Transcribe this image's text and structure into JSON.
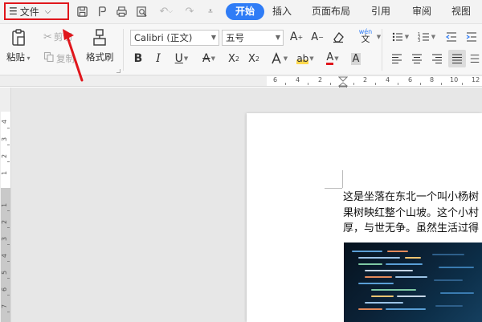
{
  "menubar": {
    "file_menu_label": "文件",
    "tabs": [
      {
        "label": "开始",
        "active": true
      },
      {
        "label": "插入",
        "active": false
      },
      {
        "label": "页面布局",
        "active": false
      },
      {
        "label": "引用",
        "active": false
      },
      {
        "label": "审阅",
        "active": false
      },
      {
        "label": "视图",
        "active": false
      }
    ]
  },
  "ribbon": {
    "paste_label": "粘贴",
    "cut_label": "剪切",
    "copy_label": "复制",
    "format_painter_label": "格式刷",
    "font_name": "Calibri (正文)",
    "font_size": "五号",
    "phonetic_top": "wén",
    "phonetic_bottom": "文"
  },
  "ruler": {
    "h_numbers": [
      "6",
      "4",
      "2",
      "2",
      "4",
      "6",
      "8",
      "10",
      "12"
    ],
    "v_numbers": [
      "4",
      "3",
      "2",
      "1",
      "1",
      "2",
      "3",
      "4",
      "5",
      "6",
      "7"
    ]
  },
  "document": {
    "lines": [
      "这是坐落在东北一个叫小杨树",
      "果树映红整个山坡。这个小村",
      "厚，与世无争。虽然生活过得"
    ]
  },
  "colors": {
    "accent": "#2f7cf6",
    "annotation": "#e0161c"
  }
}
